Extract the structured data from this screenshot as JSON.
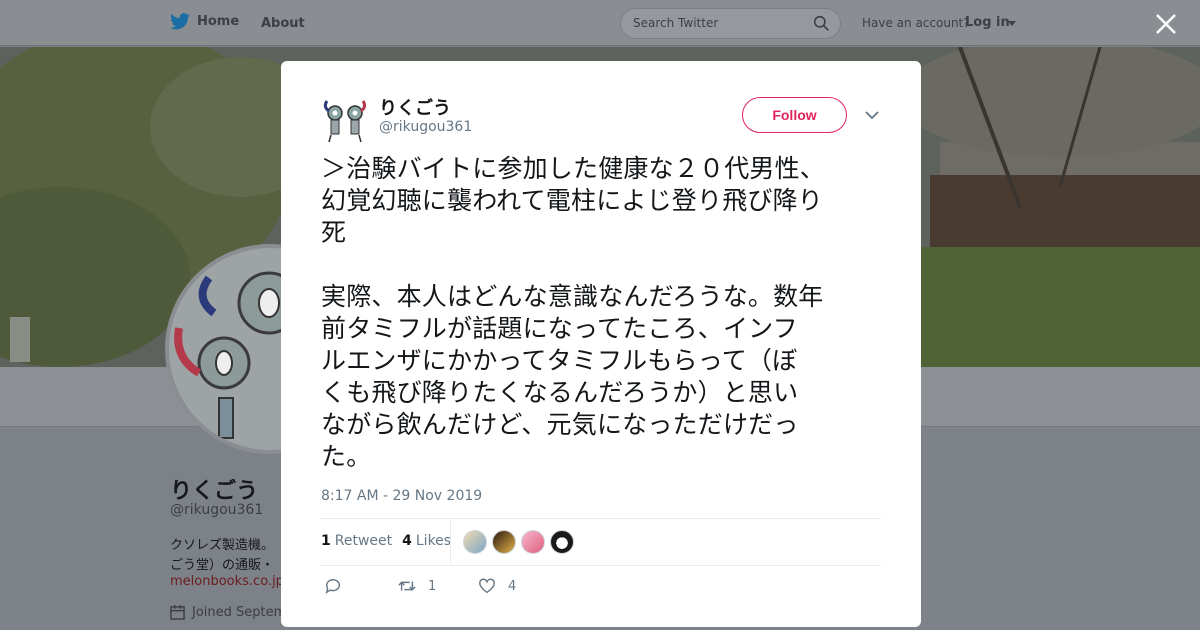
{
  "topbar": {
    "home_label": "Home",
    "about_label": "About",
    "search_placeholder": "Search Twitter",
    "account_text": "Have an account?",
    "login_label": "Log in"
  },
  "profile": {
    "name": "りくごう",
    "handle": "@rikugou361",
    "bio_line1": "クソレズ製造機。",
    "bio_line2": "ごう堂）の通販・",
    "link": "melonbooks.co.jp",
    "joined": "Joined Septem"
  },
  "tweet": {
    "name": "りくごう",
    "handle": "@rikugou361",
    "follow_label": "Follow",
    "text": "＞治験バイトに参加した健康な２０代男性、\n幻覚幻聴に襲われて電柱によじ登り飛び降り\n死\n\n実際、本人はどんな意識なんだろうな。数年\n前タミフルが話題になってたころ、インフ\nルエンザにかかってタミフルもらって（ぼ\nくも飛び降りたくなるんだろうか）と思い\nながら飲んだけど、元気になっただけだっ\nた。",
    "timestamp": "8:17 AM - 29 Nov 2019",
    "retweets_count": "1",
    "retweets_label": "Retweet",
    "likes_count": "4",
    "likes_label": "Likes",
    "action_retweet_count": "1",
    "action_like_count": "4"
  },
  "colors": {
    "accent": "#e0245e",
    "twitter_blue": "#1da1f2",
    "muted": "#657786"
  }
}
